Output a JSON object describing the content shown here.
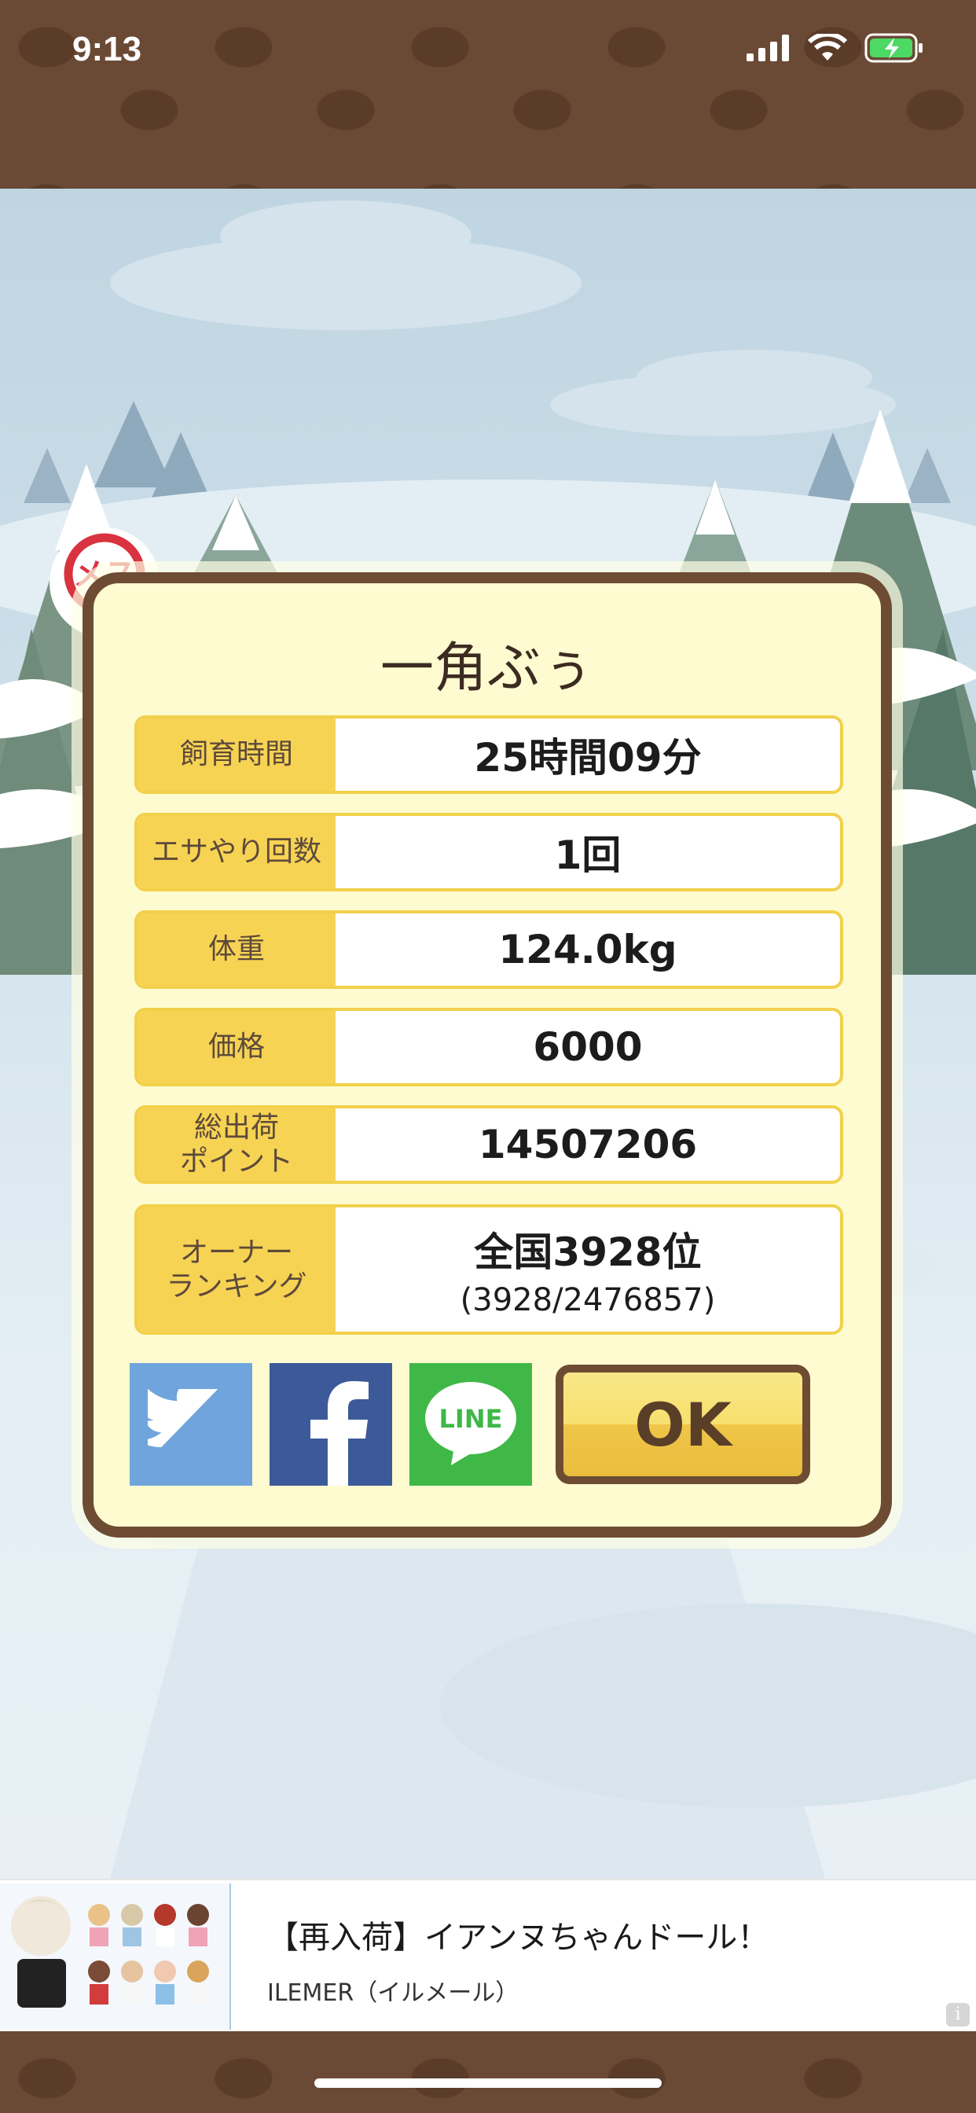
{
  "status_bar": {
    "time": "9:13"
  },
  "pig": {
    "name": "一角ぶぅ",
    "gender_badge": "メス"
  },
  "stats": [
    {
      "label": "飼育時間",
      "value": "25時間09分"
    },
    {
      "label": "エサやり回数",
      "value": "1回"
    },
    {
      "label": "体重",
      "value": "124.0kg"
    },
    {
      "label": "価格",
      "value": "6000"
    },
    {
      "label": "総出荷\nポイント",
      "value": "14507206"
    },
    {
      "label": "オーナー\nランキング",
      "value": "全国3928位",
      "sub": "(3928/2476857)"
    }
  ],
  "share": {
    "line_label": "LINE"
  },
  "ok_label": "OK",
  "ad": {
    "title": "【再入荷】イアンヌちゃんドール！",
    "advertiser": "ILEMER（イルメール）",
    "info_icon": "i"
  },
  "colors": {
    "brown": "#6d4c33",
    "panel": "#fffbd0",
    "label_bg": "#f7d354",
    "badge_red": "#d8333f"
  }
}
